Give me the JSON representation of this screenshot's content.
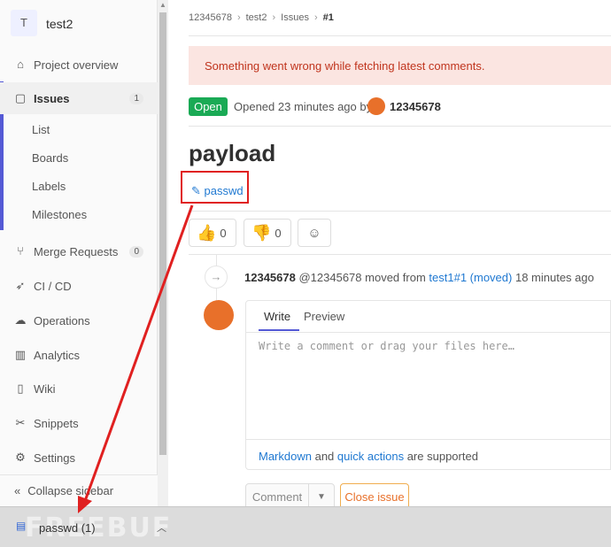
{
  "project": {
    "avatar_letter": "T",
    "name": "test2"
  },
  "sidebar": {
    "items": [
      {
        "label": "Project overview",
        "icon": "home-icon"
      },
      {
        "label": "Issues",
        "icon": "issues-icon",
        "count": "1"
      },
      {
        "label": "Merge Requests",
        "icon": "merge-request-icon",
        "count": "0"
      },
      {
        "label": "CI / CD",
        "icon": "rocket-icon"
      },
      {
        "label": "Operations",
        "icon": "cloud-gear-icon"
      },
      {
        "label": "Analytics",
        "icon": "chart-icon"
      },
      {
        "label": "Wiki",
        "icon": "book-icon"
      },
      {
        "label": "Snippets",
        "icon": "scissors-icon"
      },
      {
        "label": "Settings",
        "icon": "gear-icon"
      }
    ],
    "issues_subnav": [
      "List",
      "Boards",
      "Labels",
      "Milestones"
    ],
    "collapse_label": "Collapse sidebar"
  },
  "breadcrumb": [
    "12345678",
    "test2",
    "Issues",
    "#1"
  ],
  "alert": "Something went wrong while fetching latest comments.",
  "issue": {
    "status": "Open",
    "opened_text": "Opened 23 minutes ago by",
    "author": "12345678",
    "title": "payload",
    "attachment": "passwd"
  },
  "emoji": {
    "thumbs_up_count": "0",
    "thumbs_down_count": "0"
  },
  "system_note": {
    "author": "12345678",
    "handle": "@12345678",
    "action": "moved from",
    "link": "test1#1 (moved)",
    "time": "18 minutes ago"
  },
  "editor": {
    "tab_write": "Write",
    "tab_preview": "Preview",
    "placeholder": "Write a comment or drag your files here…",
    "markdown_link": "Markdown",
    "and": "and",
    "quick_actions_link": "quick actions",
    "supported": "are supported"
  },
  "buttons": {
    "comment": "Comment",
    "close_issue": "Close issue"
  },
  "download": {
    "filename": "passwd (1)"
  },
  "watermark": "FREEBUF",
  "colors": {
    "accent": "#5459d5",
    "open": "#1aaa55",
    "alert_bg": "#fbe5e1",
    "alert_text": "#c0341d",
    "link": "#1f78d1",
    "annotation": "#e02020"
  }
}
